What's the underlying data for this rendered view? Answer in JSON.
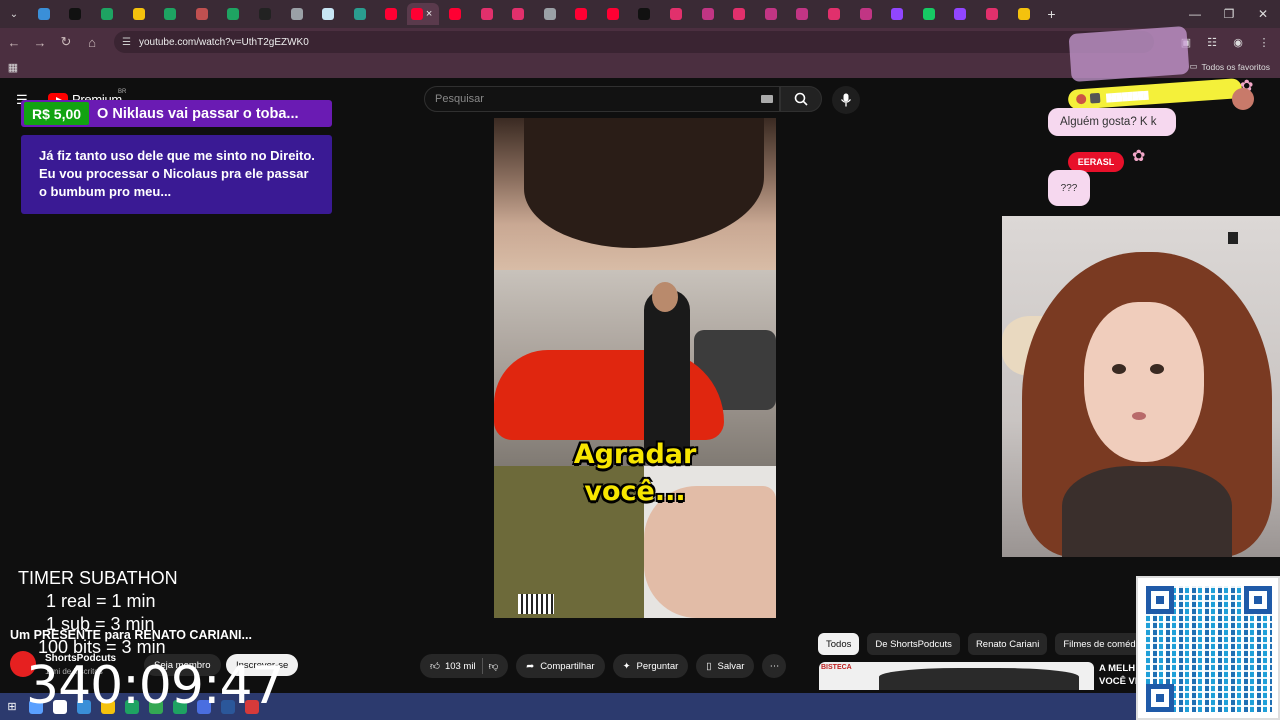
{
  "browser": {
    "tab_favicon_colors": [
      "#3a8fd8",
      "#111111",
      "#1ea362",
      "#f4c20d",
      "#1ea362",
      "#c05050",
      "#1ea362",
      "#222222",
      "#9aa0a6",
      "#c8e6f5",
      "#2a9d8f",
      "#ff0033",
      "#ff0033",
      "#ff0033",
      "#e1306c",
      "#e1306c",
      "#9aa0a6",
      "#ff0033",
      "#ff0033",
      "#111111",
      "#e1306c",
      "#c13584",
      "#e1306c",
      "#c13584",
      "#c13584",
      "#e1306c",
      "#c13584",
      "#9146ff",
      "#17c964",
      "#9146ff",
      "#e1306c",
      "#f4c20d"
    ],
    "active_tab_index": 12,
    "tab_close": "×",
    "new_tab": "+",
    "url": "youtube.com/watch?v=UthT2gEZWK0",
    "all_favorites": "Todos os favoritos"
  },
  "youtube": {
    "logo_text": "Premium",
    "country": "BR",
    "search_placeholder": "Pesquisar"
  },
  "superchat": {
    "amount": "R$ 5,00",
    "title": "O Niklaus vai passar o toba...",
    "body": "Já fiz tanto uso dele que me sinto no Direito. Eu vou processar o Nicolaus pra ele passar o bumbum pro meu..."
  },
  "video": {
    "caption_line1": "Agradar",
    "caption_line2": "você..."
  },
  "chat": {
    "user1": "CHECK_MARK_HERE",
    "msg1": "Alguém gosta? K k",
    "user2": "EERASL",
    "msg2": "???"
  },
  "timer": {
    "title": "TIMER SUBATHON",
    "line1": "1 real = 1 min",
    "line2": "1 sub = 3 min",
    "line3": "100 bits = 3 min",
    "time": "340:09:47"
  },
  "video_info": {
    "title": "Um PRESENTE para RENATO CARIANI...",
    "channel": "ShortsPodcuts",
    "subs": "1 mi de inscritos",
    "member_button": "Seja membro",
    "subscribe_button": "Inscrever-se",
    "likes": "103 mil",
    "share": "Compartilhar",
    "ask": "Perguntar",
    "save": "Salvar"
  },
  "recommend": {
    "chips": [
      "Todos",
      "De ShortsPodcuts",
      "Renato Cariani",
      "Filmes de comédia"
    ],
    "title_line1": "A MELH",
    "title_line2": "VOCÊ VI",
    "thumb_logo": "BISTECA"
  },
  "taskbar": {
    "icon_colors": [
      "#5aa0ff",
      "#ffffff",
      "#3a8fd8",
      "#f4c20d",
      "#1ea362",
      "#34a853",
      "#1ea362",
      "#4a6ee0",
      "#2b579a",
      "#d63a3a"
    ]
  }
}
